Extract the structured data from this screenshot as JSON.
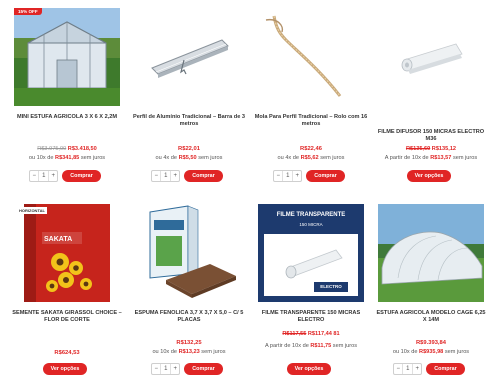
{
  "products": [
    {
      "badge": "15% OFF",
      "name": "MINI ESTUFA AGRICOLA 3 X 6 X 2,2M",
      "old_price": "R$3.975,00",
      "price": "R$3.418,50",
      "install_prefix": "ou 10x de",
      "install_value": "R$341,85",
      "install_suffix": "sem juros",
      "qty": "1",
      "button": "Comprar"
    },
    {
      "name": "Perfil de Alumínio Tradicional – Barra de 3 metros",
      "price": "R$22,01",
      "install_prefix": "ou 4x de",
      "install_value": "R$5,50",
      "install_suffix": "sem juros",
      "qty": "1",
      "button": "Comprar"
    },
    {
      "name": "Mola Para Perfil Tradicional – Rolo com 16 metros",
      "price": "R$22,46",
      "install_prefix": "ou 4x de",
      "install_value": "R$5,62",
      "install_suffix": "sem juros",
      "qty": "1",
      "button": "Comprar"
    },
    {
      "name": "FILME DIFUSOR 150 MICRAS ELECTRO M36",
      "old_price": "R$135,69",
      "price": "R$135,12",
      "install_prefix": "A partir de 10x de",
      "install_value": "R$13,57",
      "install_suffix": "sem juros",
      "button": "Ver opções"
    },
    {
      "badge": "HORIZONTAL",
      "name": "SEMENTE SAKATA GIRASSOL CHOICE – FLOR DE CORTE",
      "price": "R$624,53",
      "button": "Ver opções",
      "packet_brand": "SAKATA"
    },
    {
      "name": "ESPUMA FENOLICA 3,7 X 3,7 X 5,0 – C/ 5 PLACAS",
      "price": "R$132,25",
      "install_prefix": "ou 10x de",
      "install_value": "R$13,23",
      "install_suffix": "sem juros",
      "qty": "1",
      "button": "Comprar"
    },
    {
      "name": "FILME TRANSPARENTE 150 MICRAS ELECTRO",
      "old_price": "R$117,55",
      "price": "R$117,44 81",
      "install_prefix": "A partir de 10x de",
      "install_value": "R$11,75",
      "install_suffix": "sem juros",
      "button": "Ver opções",
      "banner_title": "FILME TRANSPARENTE",
      "banner_sub": "150 MICRA",
      "brand": "ELECTRO"
    },
    {
      "name": "ESTUFA AGRICOLA MODELO CAGE 6,25 X 14M",
      "price": "R$9.393,84",
      "install_prefix": "ou 10x de",
      "install_value": "R$935,98",
      "install_suffix": "sem juros",
      "qty": "1",
      "button": "Comprar"
    }
  ],
  "colors": {
    "accent": "#e02525"
  }
}
